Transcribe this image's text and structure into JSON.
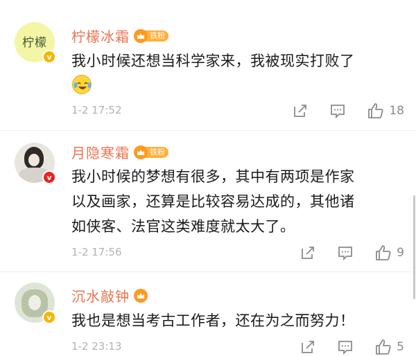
{
  "comments": [
    {
      "username": "柠檬冰霜",
      "fan_label": "铁粉",
      "avatar_text": "柠檬",
      "text": "我小时候还想当科学家来，我被现实打败了",
      "emoji": "laughing-crying-emoji",
      "time": "1-2 17:52",
      "likes": "18",
      "verified_color": "#f7b500"
    },
    {
      "username": "月隐寒霜",
      "fan_label": "铁粉",
      "text_lines": [
        "我小时候的梦想有很多，其中有两项是作家",
        "以及画家，还算是比较容易达成的，其他诸",
        "如侠客、法官这类难度就太大了。"
      ],
      "time": "1-2 17:56",
      "likes": "9",
      "verified_color": "#e8231f"
    },
    {
      "username": "沉水敲钟",
      "text": "我也是想当考古工作者，还在为之而努力！",
      "time": "1-2 23:13",
      "likes": "5",
      "verified_color": "#f7b500"
    }
  ],
  "icons": {
    "share": "share-icon",
    "comment": "comment-icon",
    "like": "thumbs-up-icon"
  },
  "colors": {
    "username": "#eb7350",
    "meta": "#b2b2b2",
    "fan_badge": "#ffb03a"
  }
}
